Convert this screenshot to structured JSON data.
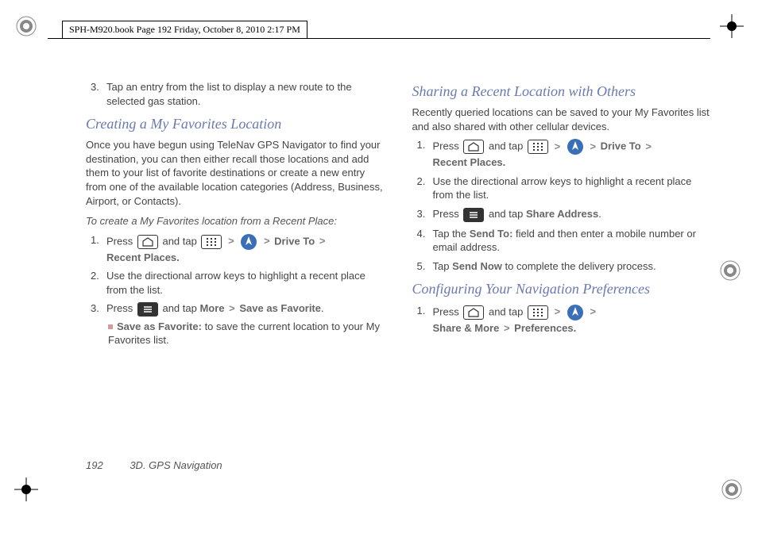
{
  "header": "SPH-M920.book  Page 192  Friday, October 8, 2010  2:17 PM",
  "left": {
    "step3": {
      "num": "3.",
      "text": "Tap an entry from the list to display a new route to the selected gas station."
    },
    "h_creating": "Creating a My Favorites Location",
    "p_creating": "Once you have begun using TeleNav GPS Navigator to find your destination, you can then either recall those locations and add them to your list of favorite destinations or create a new entry from one of the available location categories (Address, Business, Airport, or Contacts).",
    "lead_recent": "To create a My Favorites location from a Recent Place:",
    "s1": {
      "num": "1.",
      "pre": "Press ",
      "mid": " and tap ",
      "post1": " Drive To ",
      "post2": "Recent Places."
    },
    "s2": {
      "num": "2.",
      "text": "Use the directional arrow keys to highlight a recent place from the list."
    },
    "s3": {
      "num": "3.",
      "pre": "Press ",
      "mid": " and tap ",
      "more": "More",
      "save": "Save as Favorite",
      "dot": "."
    },
    "s3sub_label": "Save as Favorite:",
    "s3sub_text": " to save the current location to your My Favorites list.",
    "sep": ">"
  },
  "right": {
    "h_sharing": "Sharing a Recent Location with Others",
    "p_sharing": "Recently queried locations can be saved to your My Favorites list and also shared with other cellular devices.",
    "s1": {
      "num": "1.",
      "pre": "Press ",
      "mid": " and tap ",
      "drive": "Drive To",
      "recent": "Recent Places."
    },
    "s2": {
      "num": "2.",
      "text": "Use the directional arrow keys to highlight a recent place from the list."
    },
    "s3": {
      "num": "3.",
      "pre": "Press ",
      "mid": " and tap ",
      "share": "Share Address",
      "dot": "."
    },
    "s4": {
      "num": "4.",
      "pre": "Tap the ",
      "sendto": "Send To:",
      "post": " field and then enter a mobile number or email address."
    },
    "s5": {
      "num": "5.",
      "pre": "Tap ",
      "sendnow": "Send Now",
      "post": " to complete the delivery process."
    },
    "h_config": "Configuring Your Navigation Preferences",
    "c1": {
      "num": "1.",
      "pre": "Press ",
      "mid": " and tap ",
      "sm": "Share & More",
      "pref": "Preferences."
    },
    "sep": ">"
  },
  "footer": {
    "page": "192",
    "chapter": "3D. GPS Navigation"
  }
}
